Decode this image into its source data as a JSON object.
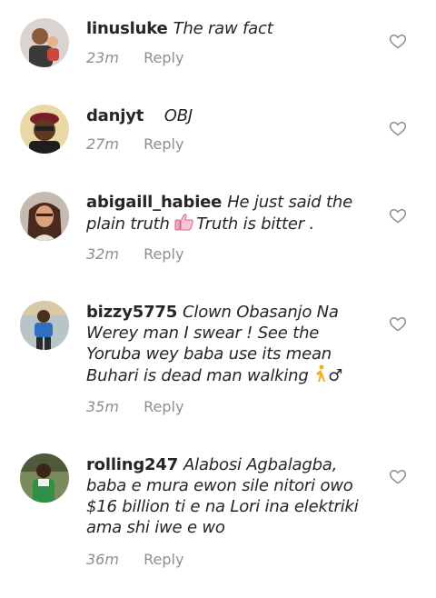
{
  "comments": [
    {
      "username": "linusluke",
      "text": "The raw fact",
      "time": "23m",
      "reply": "Reply"
    },
    {
      "username": "danjyt",
      "text": "   OBJ",
      "time": "27m",
      "reply": "Reply"
    },
    {
      "username": "abigaill_habiee",
      "text_before": "He just said the plain truth ",
      "emoji": "thumbs-up-icon",
      "text_after": "Truth is bitter .",
      "time": "32m",
      "reply": "Reply"
    },
    {
      "username": "bizzy5775",
      "text": "Clown   Obasanjo Na Werey man I swear ! See the Yoruba wey baba use its mean Buhari is dead man walking ",
      "trailing": "♂",
      "emoji": "person-walking-icon",
      "time": "35m",
      "reply": "Reply"
    },
    {
      "username": "rolling247",
      "text": "Alabosi Agbalagba, baba e mura ewon sile nitori owo $16 billion ti e na Lori ina elektriki ama shi iwe e wo",
      "time": "36m",
      "reply": "Reply"
    }
  ],
  "icons": {
    "like": "heart-outline-icon"
  },
  "colors": {
    "text": "#262626",
    "meta": "#8e8e8e",
    "heart_stroke": "#8e8e8e"
  }
}
